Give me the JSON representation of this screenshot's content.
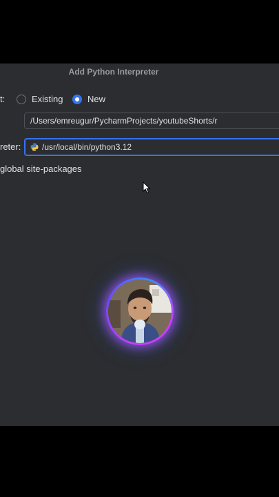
{
  "dialog": {
    "title": "Add Python Interpreter",
    "environment_label": "t:",
    "radios": {
      "existing_label": "Existing",
      "new_label": "New",
      "selected": "New"
    },
    "location_value": "/Users/emreugur/PycharmProjects/youtubeShorts/r",
    "base_interpreter_label": "reter:",
    "base_interpreter_value": "/usr/local/bin/python3.12",
    "inherit_label": "global site-packages"
  },
  "colors": {
    "accent": "#3574f0",
    "background": "#2b2d30",
    "text": "#dfe1e5",
    "title": "#9a9ca1"
  },
  "icons": {
    "interpreter": "python-icon",
    "pointer": "mouse-cursor-icon"
  }
}
